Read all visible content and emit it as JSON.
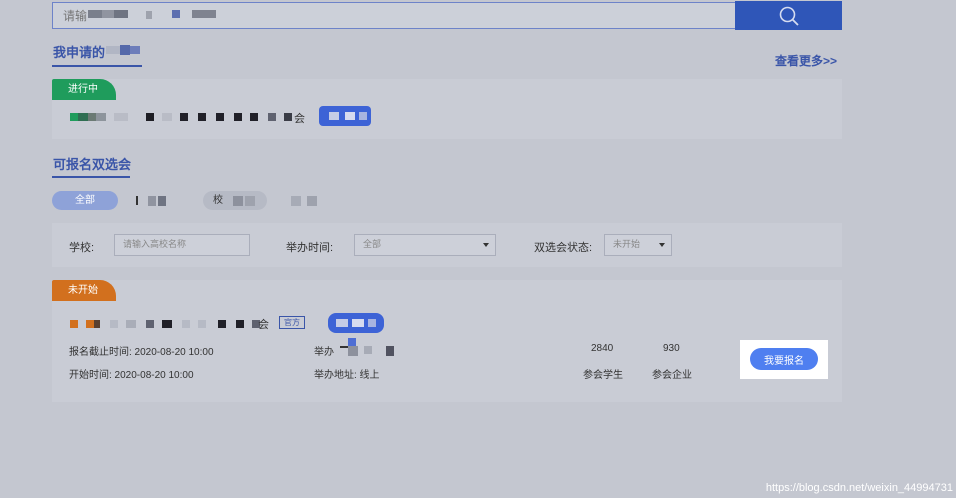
{
  "search": {
    "placeholder": "请输"
  },
  "my_applied": {
    "title": "我申请的",
    "more": "查看更多>>"
  },
  "ongoing_card": {
    "status": "进行中",
    "title_suffix": "会"
  },
  "available": {
    "title": "可报名双选会"
  },
  "filter_tabs": [
    "全部",
    "",
    "校",
    ""
  ],
  "filters": {
    "school_label": "学校:",
    "school_placeholder": "请输入高校名称",
    "time_label": "举办时间:",
    "time_value": "全部",
    "status_label": "双选会状态:",
    "status_value": "未开始"
  },
  "fair_card": {
    "status": "未开始",
    "title_suffix": "会",
    "official_tag": "官方",
    "deadline": "报名截止时间: 2020-08-20 10:00",
    "start_time": "开始时间: 2020-08-20 10:00",
    "organizer_label": "举办",
    "address": "举办地址: 线上",
    "students_count": "2840",
    "students_label": "参会学生",
    "companies_count": "930",
    "companies_label": "参会企业",
    "apply_label": "我要报名"
  },
  "watermark": "https://blog.csdn.net/weixin_44994731"
}
